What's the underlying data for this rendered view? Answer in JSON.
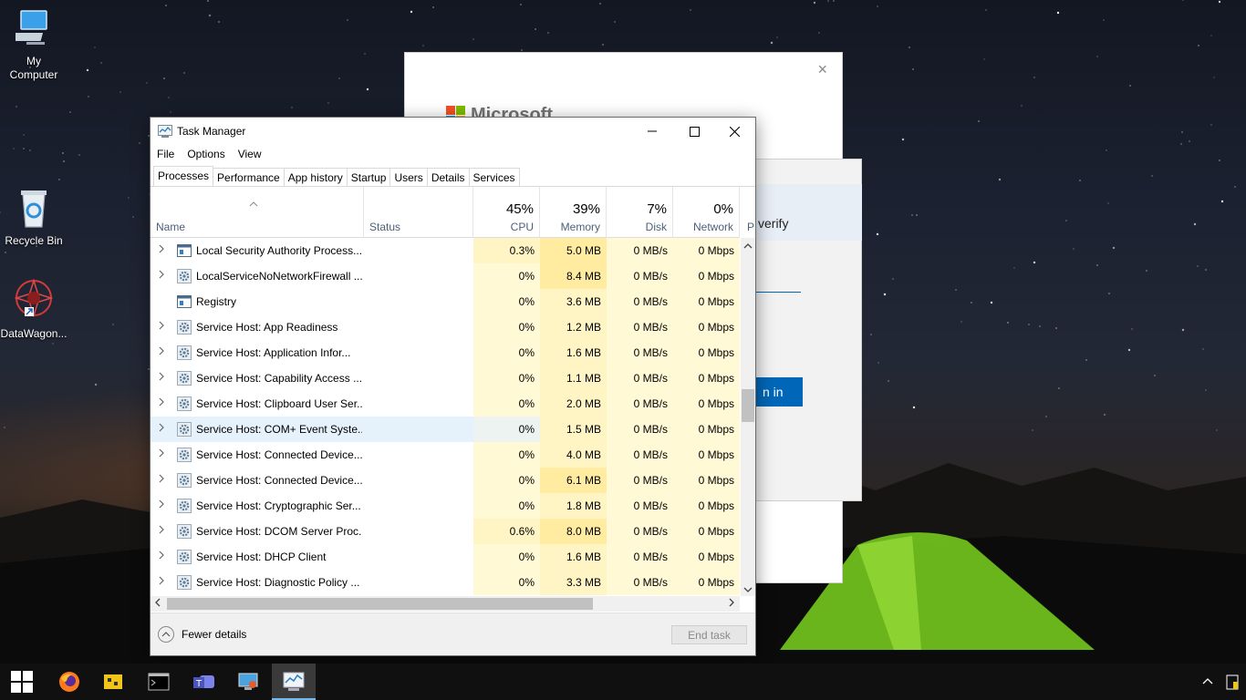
{
  "desktop": {
    "icons": [
      {
        "name": "My Computer",
        "line1": "My",
        "line2": "Computer"
      },
      {
        "name": "Recycle Bin",
        "line1": "Recycle Bin",
        "line2": ""
      },
      {
        "name": "DataWagon...",
        "line1": "DataWagon...",
        "line2": ""
      }
    ]
  },
  "ms_dialog": {
    "brand": "Microsoft",
    "close": "×",
    "verify_text": "verify",
    "signin_text": "n in",
    "colors": {
      "red": "#f25022",
      "green": "#7fba00",
      "blue": "#00a4ef",
      "yellow": "#ffb900",
      "button": "#0067b8"
    }
  },
  "task_manager": {
    "title": "Task Manager",
    "window_buttons": {
      "minimize": "—",
      "maximize": "☐",
      "close": "✕"
    },
    "menu": [
      "File",
      "Options",
      "View"
    ],
    "tabs": [
      "Processes",
      "Performance",
      "App history",
      "Startup",
      "Users",
      "Details",
      "Services"
    ],
    "active_tab": "Processes",
    "columns": {
      "name": "Name",
      "status": "Status",
      "cpu": {
        "percent": "45%",
        "label": "CPU"
      },
      "memory": {
        "percent": "39%",
        "label": "Memory"
      },
      "disk": {
        "percent": "7%",
        "label": "Disk"
      },
      "network": {
        "percent": "0%",
        "label": "Network"
      },
      "power_partial": "P"
    },
    "rows": [
      {
        "name": "Local Security Authority Process...",
        "expandable": true,
        "icon": "window-icon",
        "cpu": "0.3%",
        "mem": "5.0 MB",
        "disk": "0 MB/s",
        "net": "0 Mbps",
        "highlight": false
      },
      {
        "name": "LocalServiceNoNetworkFirewall ...",
        "expandable": true,
        "icon": "gear-icon",
        "cpu": "0%",
        "mem": "8.4 MB",
        "disk": "0 MB/s",
        "net": "0 Mbps",
        "highlight": false
      },
      {
        "name": "Registry",
        "expandable": false,
        "icon": "window-icon",
        "cpu": "0%",
        "mem": "3.6 MB",
        "disk": "0 MB/s",
        "net": "0 Mbps",
        "highlight": false
      },
      {
        "name": "Service Host: App Readiness",
        "expandable": true,
        "icon": "gear-icon",
        "cpu": "0%",
        "mem": "1.2 MB",
        "disk": "0 MB/s",
        "net": "0 Mbps",
        "highlight": false
      },
      {
        "name": "Service Host: Application Infor...",
        "expandable": true,
        "icon": "gear-icon",
        "cpu": "0%",
        "mem": "1.6 MB",
        "disk": "0 MB/s",
        "net": "0 Mbps",
        "highlight": false
      },
      {
        "name": "Service Host: Capability Access ...",
        "expandable": true,
        "icon": "gear-icon",
        "cpu": "0%",
        "mem": "1.1 MB",
        "disk": "0 MB/s",
        "net": "0 Mbps",
        "highlight": false
      },
      {
        "name": "Service Host: Clipboard User Ser...",
        "expandable": true,
        "icon": "gear-icon",
        "cpu": "0%",
        "mem": "2.0 MB",
        "disk": "0 MB/s",
        "net": "0 Mbps",
        "highlight": false
      },
      {
        "name": "Service Host: COM+ Event Syste...",
        "expandable": true,
        "icon": "gear-icon",
        "cpu": "0%",
        "mem": "1.5 MB",
        "disk": "0 MB/s",
        "net": "0 Mbps",
        "highlight": true
      },
      {
        "name": "Service Host: Connected Device...",
        "expandable": true,
        "icon": "gear-icon",
        "cpu": "0%",
        "mem": "4.0 MB",
        "disk": "0 MB/s",
        "net": "0 Mbps",
        "highlight": false
      },
      {
        "name": "Service Host: Connected Device...",
        "expandable": true,
        "icon": "gear-icon",
        "cpu": "0%",
        "mem": "6.1 MB",
        "disk": "0 MB/s",
        "net": "0 Mbps",
        "highlight": false
      },
      {
        "name": "Service Host: Cryptographic Ser...",
        "expandable": true,
        "icon": "gear-icon",
        "cpu": "0%",
        "mem": "1.8 MB",
        "disk": "0 MB/s",
        "net": "0 Mbps",
        "highlight": false
      },
      {
        "name": "Service Host: DCOM Server Proc...",
        "expandable": true,
        "icon": "gear-icon",
        "cpu": "0.6%",
        "mem": "8.0 MB",
        "disk": "0 MB/s",
        "net": "0 Mbps",
        "highlight": false
      },
      {
        "name": "Service Host: DHCP Client",
        "expandable": true,
        "icon": "gear-icon",
        "cpu": "0%",
        "mem": "1.6 MB",
        "disk": "0 MB/s",
        "net": "0 Mbps",
        "highlight": false
      },
      {
        "name": "Service Host: Diagnostic Policy ...",
        "expandable": true,
        "icon": "gear-icon",
        "cpu": "0%",
        "mem": "3.3 MB",
        "disk": "0 MB/s",
        "net": "0 Mbps",
        "highlight": false
      }
    ],
    "fewer_details": "Fewer details",
    "end_task": "End task",
    "colors": {
      "heat_light": "#fff9d6",
      "heat_mid": "#fff4c4",
      "heat_hot": "#ffeca0",
      "highlight": "#e5f1fb"
    }
  },
  "taskbar": {
    "items": [
      "start-icon",
      "firefox-icon",
      "file-tool-icon",
      "terminal-icon",
      "teams-icon",
      "remote-desktop-icon",
      "task-manager-icon"
    ],
    "active_item": "task-manager-icon",
    "tray_caret": "^"
  }
}
